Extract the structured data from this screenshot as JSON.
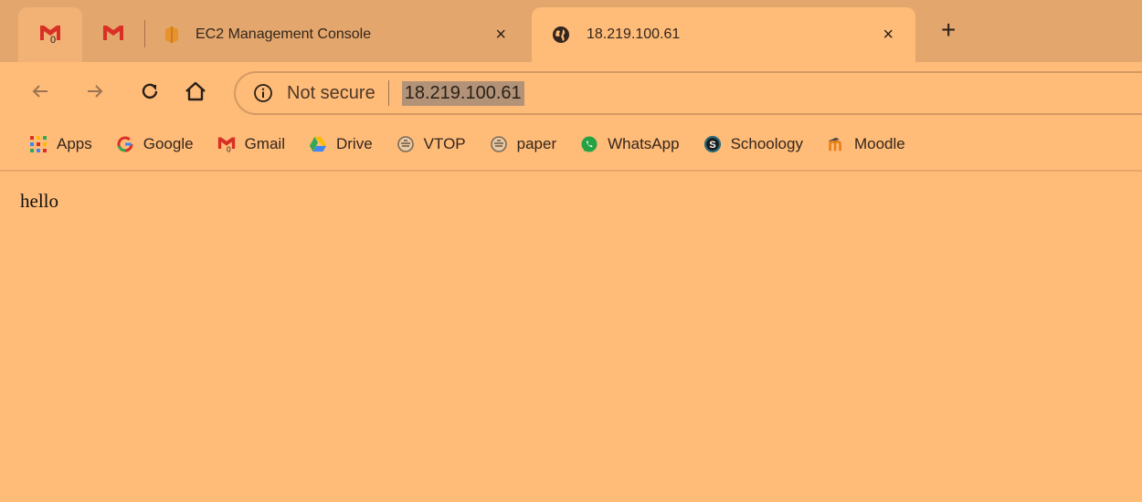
{
  "tabs": [
    {
      "id": "gmail-pinned",
      "title": "",
      "icon": "gmail-icon",
      "pinned": true
    },
    {
      "id": "gmail-pinned-2",
      "title": "",
      "icon": "gmail-icon",
      "pinned": true
    },
    {
      "id": "ec2",
      "title": "EC2 Management Console",
      "icon": "aws-icon",
      "close": "×"
    },
    {
      "id": "active",
      "title": "18.219.100.61",
      "icon": "globe-icon",
      "close": "×",
      "active": true
    }
  ],
  "new_tab_label": "+",
  "omnibox": {
    "security_text": "Not secure",
    "url": "18.219.100.61"
  },
  "bookmarks": [
    {
      "label": "Apps",
      "icon": "apps-grid-icon"
    },
    {
      "label": "Google",
      "icon": "google-icon"
    },
    {
      "label": "Gmail",
      "icon": "gmail-icon"
    },
    {
      "label": "Drive",
      "icon": "drive-icon"
    },
    {
      "label": "VTOP",
      "icon": "vtop-icon"
    },
    {
      "label": "paper",
      "icon": "vtop-icon"
    },
    {
      "label": "WhatsApp",
      "icon": "whatsapp-icon"
    },
    {
      "label": "Schoology",
      "icon": "schoology-icon"
    },
    {
      "label": "Moodle",
      "icon": "moodle-icon"
    }
  ],
  "page": {
    "body_text": "hello"
  },
  "colors": {
    "page_background": "#ffbb78",
    "tabstrip_background": "#e3a66d",
    "gmail_red": "#d93025",
    "aws_orange": "#e8922b"
  }
}
